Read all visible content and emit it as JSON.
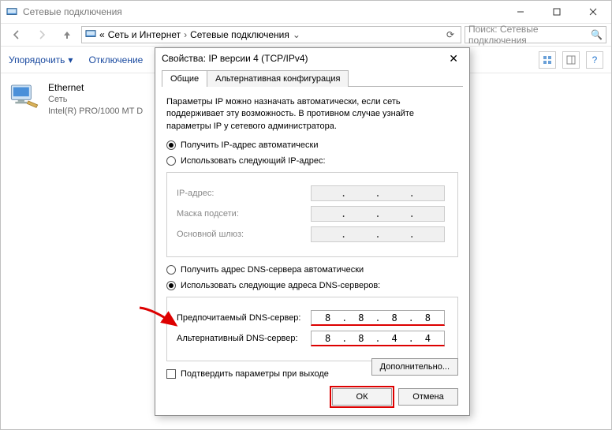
{
  "window": {
    "title": "Сетевые подключения",
    "breadcrumb": {
      "lead": "«",
      "part1": "Сеть и Интернет",
      "part2": "Сетевые подключения"
    },
    "search_placeholder": "Поиск: Сетевые подключения",
    "toolbar": {
      "organize": "Упорядочить",
      "disable": "Отключение"
    }
  },
  "adapter": {
    "name": "Ethernet",
    "status": "Сеть",
    "driver": "Intel(R) PRO/1000 MT D"
  },
  "dialog": {
    "title": "Свойства: IP версии 4 (TCP/IPv4)",
    "tabs": {
      "general": "Общие",
      "alt": "Альтернативная конфигурация"
    },
    "intro": "Параметры IP можно назначать автоматически, если сеть поддерживает эту возможность. В противном случае узнайте параметры IP у сетевого администратора.",
    "ip": {
      "auto": "Получить IP-адрес автоматически",
      "manual": "Использовать следующий IP-адрес:",
      "addr_lbl": "IP-адрес:",
      "mask_lbl": "Маска подсети:",
      "gw_lbl": "Основной шлюз:"
    },
    "dns": {
      "auto": "Получить адрес DNS-сервера автоматически",
      "manual": "Использовать следующие адреса DNS-серверов:",
      "pref_lbl": "Предпочитаемый DNS-сервер:",
      "alt_lbl": "Альтернативный DNS-сервер:",
      "pref_val": [
        "8",
        "8",
        "8",
        "8"
      ],
      "alt_val": [
        "8",
        "8",
        "4",
        "4"
      ]
    },
    "validate": "Подтвердить параметры при выходе",
    "advanced": "Дополнительно...",
    "ok": "ОК",
    "cancel": "Отмена"
  }
}
